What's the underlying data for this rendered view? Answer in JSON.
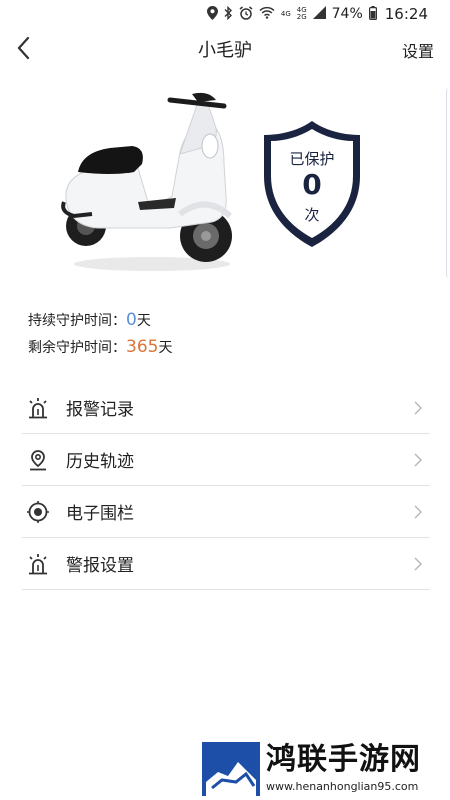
{
  "status_bar": {
    "net_a_top": "4G",
    "net_b_top": "4G",
    "net_b_bottom": "2G",
    "battery": "74%",
    "time": "16:24"
  },
  "header": {
    "title": "小毛驴",
    "settings_label": "设置"
  },
  "protection": {
    "label": "已保护",
    "count": "0",
    "unit": "次"
  },
  "stats": {
    "continuous_label": "持续守护时间：",
    "continuous_value": "0",
    "continuous_unit": "天",
    "remaining_label": "剩余守护时间：",
    "remaining_value": "365",
    "remaining_unit": "天"
  },
  "menu": {
    "items": [
      {
        "label": "报警记录",
        "icon": "alarm-light-icon"
      },
      {
        "label": "历史轨迹",
        "icon": "location-pin-icon"
      },
      {
        "label": "电子围栏",
        "icon": "target-icon"
      },
      {
        "label": "警报设置",
        "icon": "alarm-light-icon"
      }
    ]
  },
  "watermark": {
    "title": "鸿联手游网",
    "url": "www.henanhonglian95.com"
  },
  "colors": {
    "accent_blue": "#5b8fd8",
    "accent_orange": "#d9743a",
    "shield_navy": "#1a2340"
  }
}
